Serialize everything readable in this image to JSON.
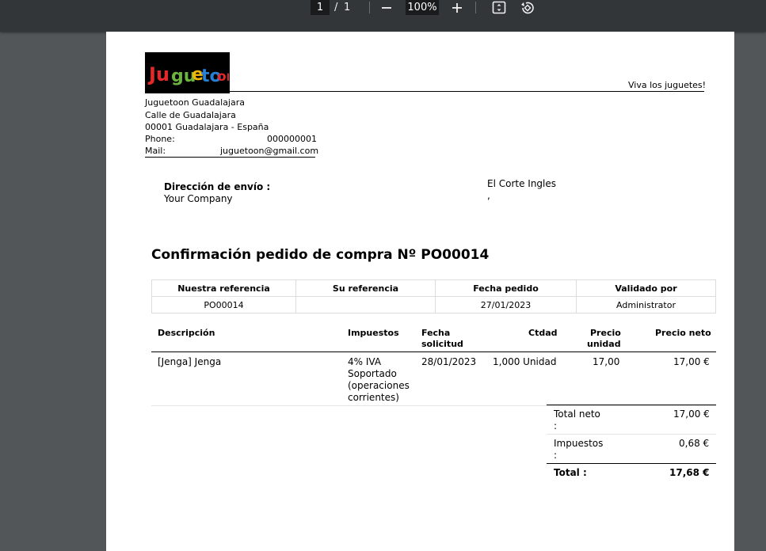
{
  "toolbar": {
    "page_current": "1",
    "page_separator": "/",
    "page_total": "1",
    "zoom_out_icon": "minus-icon",
    "zoom_value": "100%",
    "zoom_in_icon": "plus-icon",
    "fit_icon": "fit-page-icon",
    "rotate_icon": "rotate-icon"
  },
  "company": {
    "logo_text": "Juguetoon",
    "tagline": "Viva los juguetes!",
    "name": "Juguetoon Guadalajara",
    "street": "Calle de Guadalajara",
    "city": "00001 Guadalajara - España",
    "phone_label": "Phone:",
    "phone": "000000001",
    "mail_label": "Mail:",
    "mail": "juguetoon@gmail.com"
  },
  "shipping": {
    "label": "Dirección de envío :",
    "company": "Your Company",
    "vendor": "El Corte Ingles",
    "vendor_extra": ","
  },
  "title": "Confirmación pedido de compra Nº PO00014",
  "references": {
    "headers": [
      "Nuestra referencia",
      "Su referencia",
      "Fecha pedido",
      "Validado por"
    ],
    "values": [
      "PO00014",
      "",
      "27/01/2023",
      "Administrator"
    ]
  },
  "lines": {
    "headers": {
      "description": "Descripción",
      "taxes": "Impuestos",
      "date_line1": "Fecha",
      "date_line2": "solicitud",
      "qty": "Ctdad",
      "price_line1": "Precio",
      "price_line2": "unidad",
      "net": "Precio neto"
    },
    "rows": [
      {
        "description": "[Jenga] Jenga",
        "tax_l1": "4% IVA",
        "tax_l2": "Soportado",
        "tax_l3": "(operaciones",
        "tax_l4": "corrientes)",
        "date": "28/01/2023",
        "qty": "1,000 Unidad",
        "price": "17,00",
        "net": "17,00 €"
      }
    ]
  },
  "totals": {
    "net_label_l1": "Total neto",
    "net_label_l2": ":",
    "net_value": "17,00 €",
    "tax_label_l1": "Impuestos",
    "tax_label_l2": ":",
    "tax_value": "0,68 €",
    "total_label": "Total :",
    "total_value": "17,68 €"
  }
}
